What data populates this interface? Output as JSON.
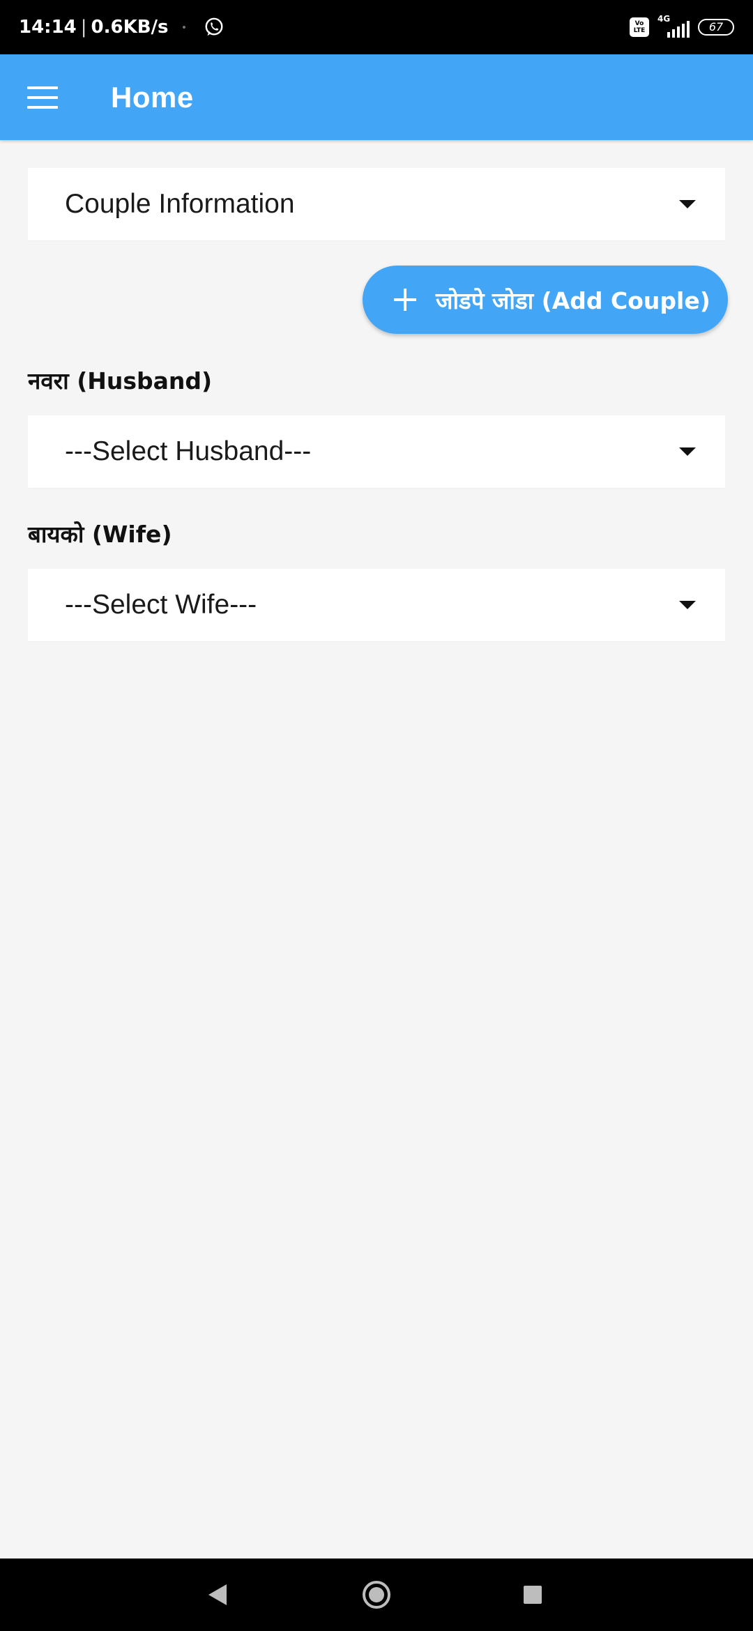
{
  "status_bar": {
    "time": "14:14",
    "separator": "|",
    "speed": "0.6KB/s",
    "volte_line1": "Vo",
    "volte_line2": "LTE",
    "network": "4G",
    "battery": "67",
    "icons": [
      "whatsapp-icon",
      "volte-icon",
      "signal-icon",
      "battery-icon"
    ]
  },
  "app_bar": {
    "title": "Home",
    "menu_icon": "menu-icon",
    "color": "#42a5f5"
  },
  "main": {
    "couple_dropdown": {
      "value": "Couple Information"
    },
    "add_couple_button": {
      "label": "जोडपे जोडा (Add Couple)",
      "icon": "plus-icon"
    },
    "husband": {
      "label": "नवरा (Husband)",
      "value": "---Select Husband---"
    },
    "wife": {
      "label": "बायको (Wife)",
      "value": "---Select Wife---"
    }
  },
  "nav_bar": {
    "icons": [
      "back-icon",
      "home-icon",
      "recent-apps-icon"
    ]
  },
  "colors": {
    "accent": "#42a5f5",
    "background": "#f5f5f5",
    "surface": "#ffffff"
  }
}
